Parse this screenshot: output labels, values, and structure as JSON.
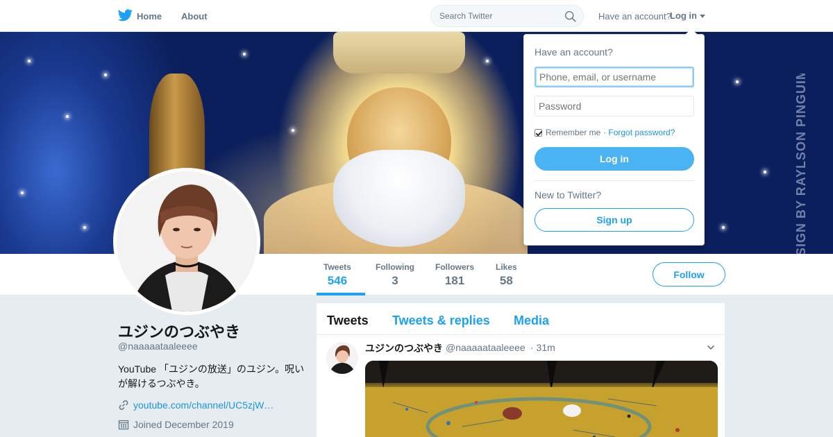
{
  "topbar": {
    "logo_icon": "twitter-bird-icon",
    "home_label": "Home",
    "about_label": "About",
    "search_placeholder": "Search Twitter",
    "have_account": "Have an account?",
    "login_label": "Log in"
  },
  "colors": {
    "accent": "#1da1f2",
    "link": "#1b95e0",
    "muted": "#657786",
    "background": "#e6ecf0"
  },
  "banner": {
    "watermark": "DESIGN BY RAYLSON PINGUIM"
  },
  "profile": {
    "display_name": "ユジンのつぶやき",
    "screen_name": "@naaaaataaleeee",
    "bio": "YouTube 「ユジンの放送」のユジン。呪いが解けるつぶやき。",
    "url": "youtube.com/channel/UC5zjW…",
    "joined": "Joined December 2019",
    "follow_label": "Follow"
  },
  "stats": [
    {
      "label": "Tweets",
      "value": "546",
      "active": true
    },
    {
      "label": "Following",
      "value": "3"
    },
    {
      "label": "Followers",
      "value": "181"
    },
    {
      "label": "Likes",
      "value": "58"
    }
  ],
  "timeline": {
    "tabs": [
      "Tweets",
      "Tweets & replies",
      "Media"
    ],
    "tweet": {
      "name": "ユジンのつぶやき",
      "handle": "@naaaaataaleeee",
      "time": "· 31m"
    }
  },
  "login_dropdown": {
    "title": "Have an account?",
    "username_placeholder": "Phone, email, or username",
    "password_placeholder": "Password",
    "remember_label": "Remember me",
    "separator": "·",
    "forgot_label": "Forgot password?",
    "login_button": "Log in",
    "new_label": "New to Twitter?",
    "signup_button": "Sign up"
  }
}
